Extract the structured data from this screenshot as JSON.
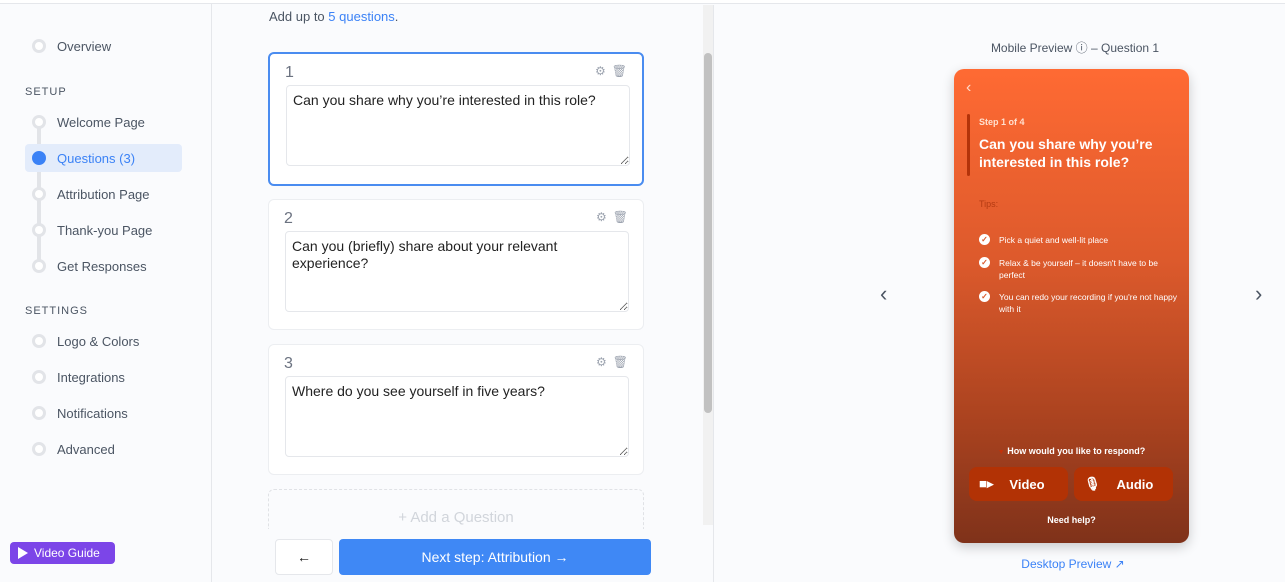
{
  "sidebar": {
    "overview": "Overview",
    "setup_heading": "SETUP",
    "setup_items": [
      {
        "label": "Welcome Page"
      },
      {
        "label": "Questions (3)",
        "active": true
      },
      {
        "label": "Attribution Page"
      },
      {
        "label": "Thank-you Page"
      },
      {
        "label": "Get Responses"
      }
    ],
    "settings_heading": "SETTINGS",
    "settings_items": [
      {
        "label": "Logo & Colors"
      },
      {
        "label": "Integrations"
      },
      {
        "label": "Notifications"
      },
      {
        "label": "Advanced"
      }
    ],
    "video_guide": "Video Guide"
  },
  "editor": {
    "intro_prefix": "Add up to ",
    "intro_link": "5 questions",
    "intro_suffix": ".",
    "questions": [
      {
        "number": "1",
        "text": "Can you share why you’re interested in this role?"
      },
      {
        "number": "2",
        "text": "Can you (briefly) share about your relevant experience?"
      },
      {
        "number": "3",
        "text": "Where do you see yourself in five years?"
      }
    ],
    "add_question": "+ Add a Question",
    "back": "←",
    "next": "Next step: Attribution →"
  },
  "preview": {
    "title_prefix": "Mobile Preview",
    "title_suffix": "– Question 1",
    "step": "Step 1 of 4",
    "question": "Can you share why you’re interested in this role?",
    "tips_label": "Tips:",
    "tips": [
      "Pick a quiet and well-lit place",
      "Relax & be yourself – it doesn't have to be perfect",
      "You can redo your recording if you're not happy with it"
    ],
    "respond_prompt": "How would you like to respond?",
    "video": "Video",
    "audio": "Audio",
    "help": "Need help?",
    "desktop_preview": "Desktop Preview ↗",
    "accent": "#ff6a33"
  }
}
